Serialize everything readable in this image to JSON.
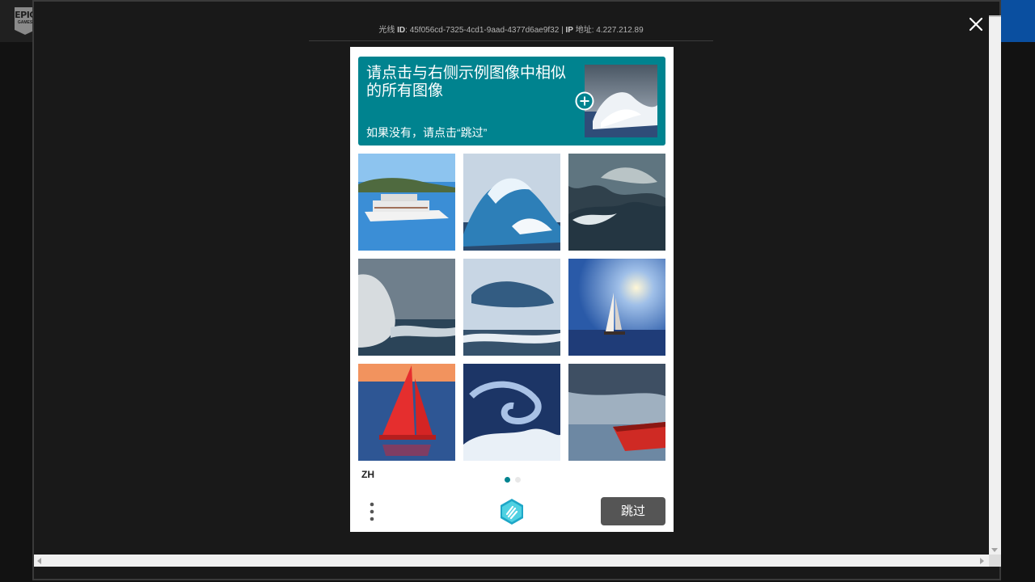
{
  "background": {
    "logo_top": "EPIC",
    "logo_bottom": "GAMES"
  },
  "ray": {
    "prefix": "光线",
    "id_label": "ID",
    "id_value": "45f056cd-7325-4cd1-9aad-4377d6ae9f32",
    "separator": "|",
    "ip_label": "IP",
    "ip_suffix": "地址",
    "ip_value": "4.227.212.89"
  },
  "captcha": {
    "title": "请点击与右侧示例图像中相似的所有图像",
    "subtitle": "如果没有，请点击“跳过”",
    "language": "ZH",
    "skip_label": "跳过",
    "accent_color": "#00838f",
    "tiles": [
      {
        "subject": "cruise ship"
      },
      {
        "subject": "large wave"
      },
      {
        "subject": "stormy sea"
      },
      {
        "subject": "sea spray"
      },
      {
        "subject": "storm cloud"
      },
      {
        "subject": "sailboat at sunset"
      },
      {
        "subject": "red sailboat"
      },
      {
        "subject": "swirling wave"
      },
      {
        "subject": "red boat"
      }
    ],
    "page_dots": 2,
    "active_page": 1
  },
  "icons": [
    "close-icon",
    "plus-icon",
    "menu-dots-icon",
    "hcaptcha-logo-icon"
  ]
}
